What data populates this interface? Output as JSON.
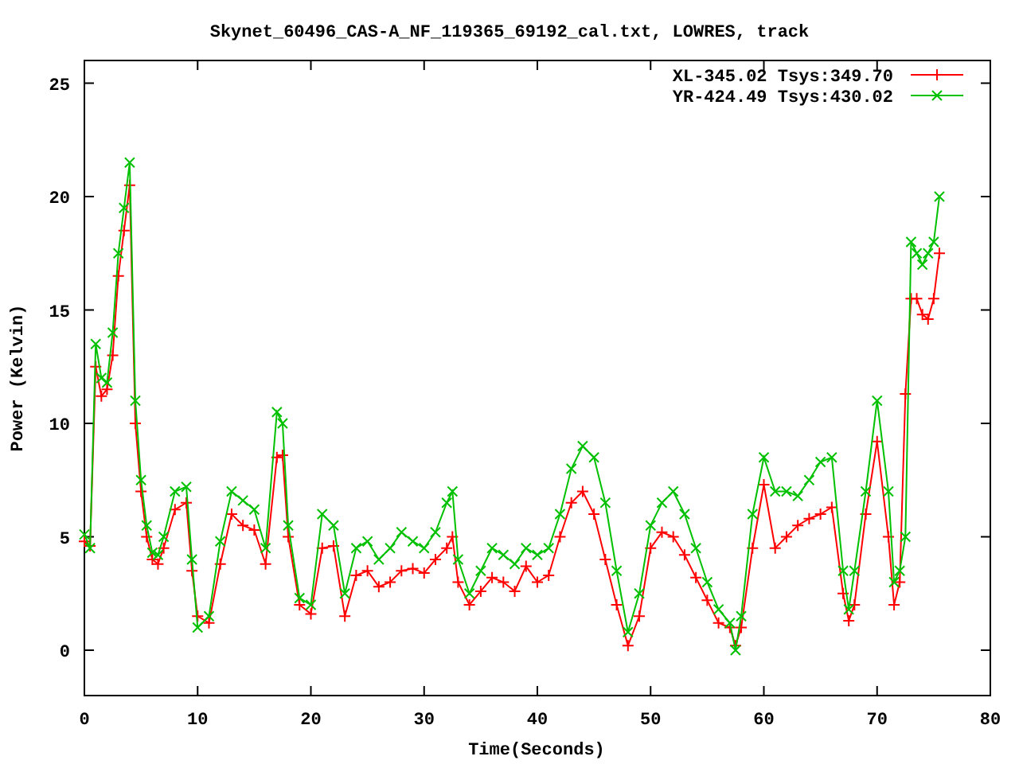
{
  "chart": {
    "chart_data": {
      "type": "line",
      "title": "Skynet_60496_CAS-A_NF_119365_69192_cal.txt, LOWRES, track",
      "xlabel": "Time(Seconds)",
      "ylabel": "Power (Kelvin)",
      "x": [
        0,
        0.5,
        1,
        1.5,
        2,
        2.5,
        3,
        3.5,
        4,
        4.5,
        5,
        5.5,
        6,
        6.5,
        7,
        8,
        9,
        9.5,
        10,
        11,
        12,
        13,
        14,
        15,
        16,
        17,
        17.5,
        18,
        19,
        20,
        21,
        22,
        23,
        24,
        25,
        26,
        27,
        28,
        29,
        30,
        31,
        32,
        32.5,
        33,
        34,
        35,
        36,
        37,
        38,
        39,
        40,
        41,
        42,
        43,
        44,
        45,
        46,
        47,
        48,
        49,
        50,
        51,
        52,
        53,
        54,
        55,
        56,
        57,
        57.5,
        58,
        59,
        60,
        61,
        62,
        63,
        64,
        65,
        66,
        67,
        67.5,
        68,
        69,
        70,
        71,
        71.5,
        72,
        72.5,
        73,
        73.5,
        74,
        74.5,
        75,
        75.5
      ],
      "series": [
        {
          "name": "XL-345.02 Tsys:349.70",
          "color": "#ff0000",
          "marker": "plus",
          "values": [
            4.8,
            4.6,
            12.5,
            11.2,
            11.5,
            13,
            16.5,
            18.5,
            20.5,
            10,
            7,
            5,
            4,
            3.8,
            4.5,
            6.2,
            6.5,
            3.5,
            1.5,
            1.2,
            3.8,
            6,
            5.5,
            5.3,
            3.8,
            8.5,
            8.6,
            5,
            2,
            1.6,
            4.5,
            4.6,
            1.5,
            3.3,
            3.5,
            2.8,
            3,
            3.5,
            3.6,
            3.4,
            4,
            4.5,
            5,
            3,
            2,
            2.6,
            3.2,
            3,
            2.6,
            3.7,
            3,
            3.3,
            5,
            6.5,
            7,
            6,
            4,
            2,
            0.2,
            1.5,
            4.5,
            5.2,
            5,
            4.2,
            3.2,
            2.2,
            1.2,
            1,
            0.2,
            1,
            4.5,
            7.3,
            4.5,
            5,
            5.5,
            5.8,
            6,
            6.3,
            2.5,
            1.3,
            2,
            6,
            9.2,
            5,
            2,
            3,
            11.3,
            15.5,
            15.5,
            14.8,
            14.6,
            15.5,
            17.5
          ]
        },
        {
          "name": "YR-424.49 Tsys:430.02",
          "color": "#00c000",
          "marker": "cross",
          "values": [
            5.1,
            4.5,
            13.5,
            12,
            11.8,
            14,
            17.5,
            19.5,
            21.5,
            11,
            7.5,
            5.5,
            4.3,
            4.2,
            5,
            7,
            7.2,
            4,
            1,
            1.5,
            4.8,
            7,
            6.6,
            6.2,
            4.5,
            10.5,
            10,
            5.5,
            2.3,
            2,
            6,
            5.5,
            2.5,
            4.5,
            4.8,
            4,
            4.5,
            5.2,
            4.8,
            4.5,
            5.2,
            6.5,
            7,
            4,
            2.5,
            3.5,
            4.5,
            4.2,
            3.8,
            4.5,
            4.2,
            4.5,
            6,
            8,
            9,
            8.5,
            6.5,
            3.5,
            0.8,
            2.5,
            5.5,
            6.5,
            7,
            6,
            4.5,
            3,
            1.8,
            1.2,
            0,
            1.5,
            6,
            8.5,
            7,
            7,
            6.8,
            7.5,
            8.3,
            8.5,
            3.5,
            1.8,
            3.5,
            7,
            11,
            7,
            3,
            3.5,
            5,
            18,
            17.5,
            17,
            17.5,
            18,
            20
          ]
        }
      ],
      "legend": true,
      "xlim": [
        0,
        80
      ],
      "ylim": [
        -2,
        26
      ],
      "xticks": [
        0,
        10,
        20,
        30,
        40,
        50,
        60,
        70,
        80
      ],
      "yticks": [
        0,
        5,
        10,
        15,
        20,
        25
      ]
    }
  }
}
